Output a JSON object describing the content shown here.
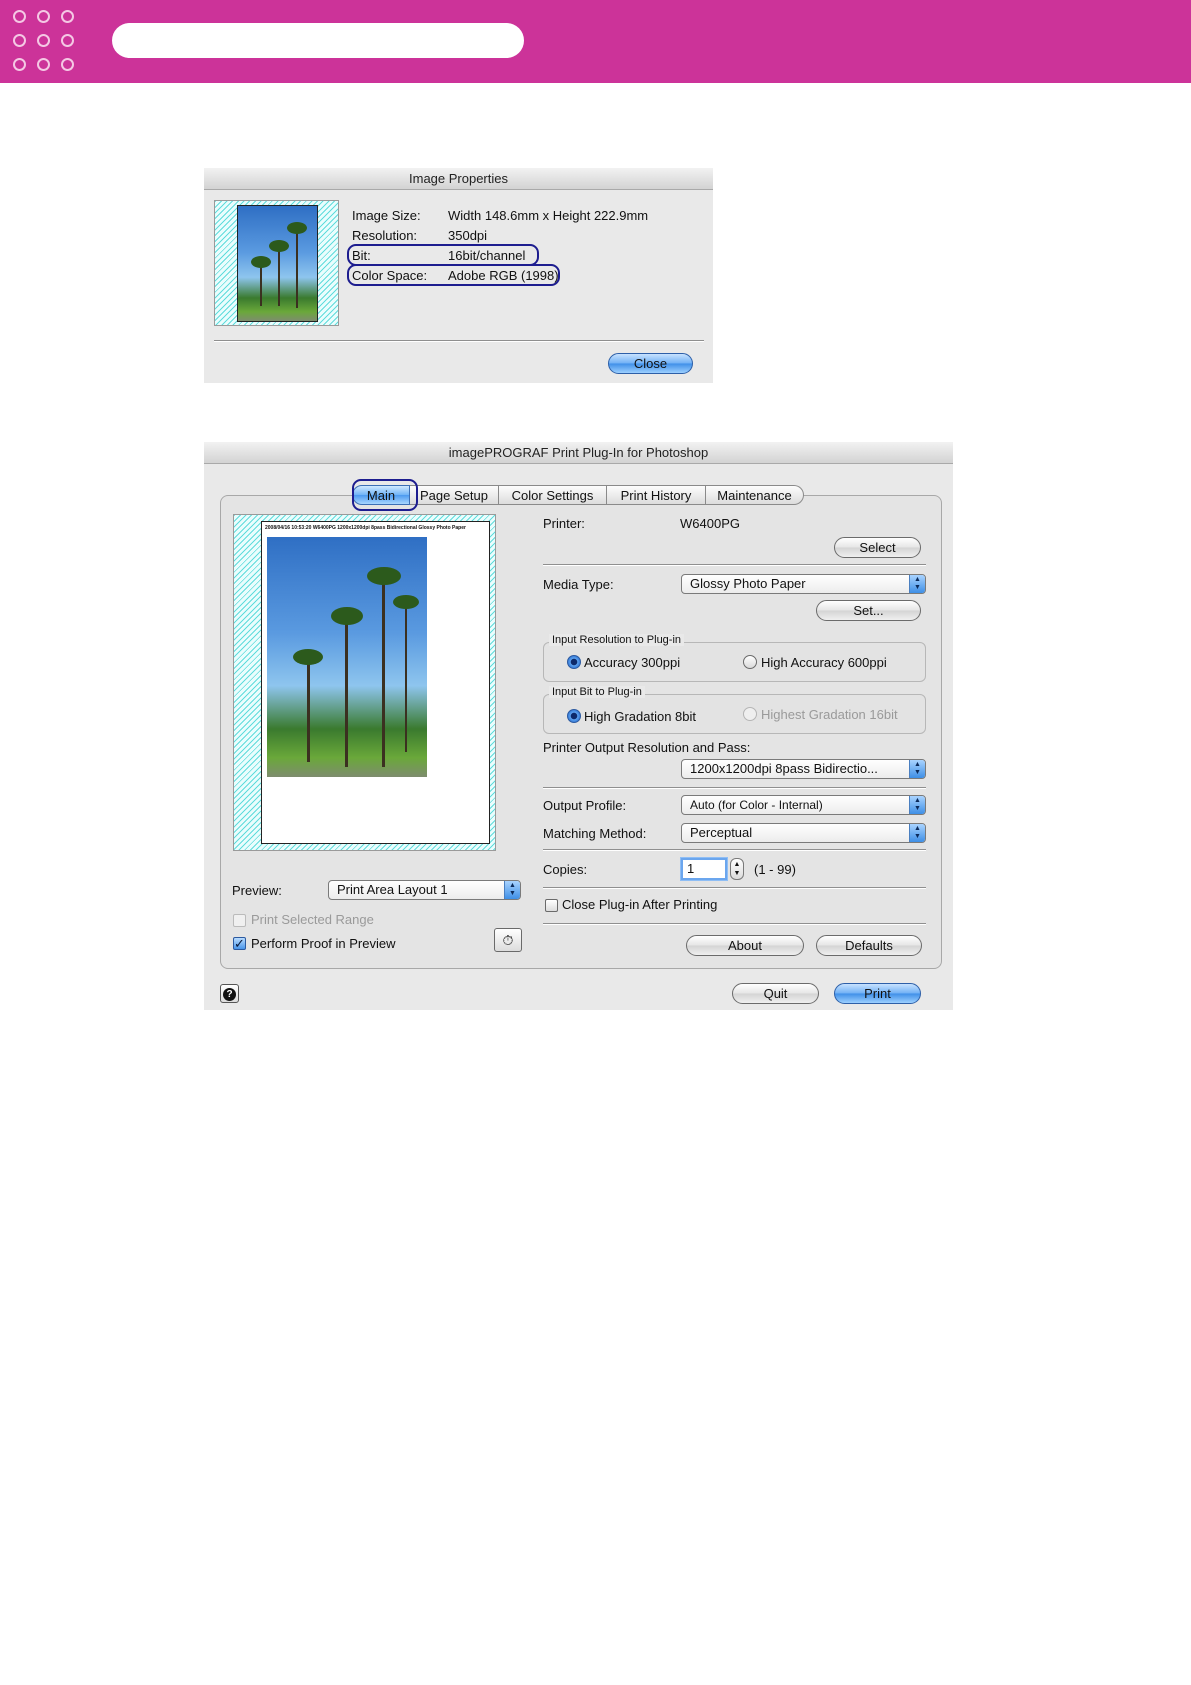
{
  "colors": {
    "banner": "#cc3399",
    "accent_highlight": "#1d1d8f",
    "window_bg": "#e9e9e9"
  },
  "image_properties": {
    "title": "Image Properties",
    "rows": [
      {
        "label": "Image Size:",
        "value": "Width 148.6mm x Height 222.9mm"
      },
      {
        "label": "Resolution:",
        "value": "350dpi"
      },
      {
        "label": "Bit:",
        "value": "16bit/channel"
      },
      {
        "label": "Color Space:",
        "value": "Adobe RGB (1998)"
      }
    ],
    "close_label": "Close"
  },
  "plugin": {
    "title": "imagePROGRAF Print Plug-In for Photoshop",
    "tabs": [
      "Main",
      "Page Setup",
      "Color Settings",
      "Print History",
      "Maintenance"
    ],
    "active_tab": "Main",
    "preview_header_text": "2008/04/16 10:53:20 W6400PG 1200x1200dpi 8pass Bidirectional Glossy Photo Paper",
    "printer_label": "Printer:",
    "printer_value": "W6400PG",
    "select_label": "Select",
    "media_type_label": "Media Type:",
    "media_type_value": "Glossy Photo Paper",
    "set_label": "Set...",
    "input_resolution": {
      "label": "Input Resolution to Plug-in",
      "option1": "Accuracy 300ppi",
      "option2": "High Accuracy 600ppi"
    },
    "input_bit": {
      "label": "Input Bit to Plug-in",
      "option1": "High Gradation 8bit",
      "option2": "Highest Gradation 16bit"
    },
    "output_resolution_label": "Printer Output Resolution and Pass:",
    "output_resolution_value": "1200x1200dpi 8pass Bidirectio...",
    "output_profile_label": "Output Profile:",
    "output_profile_value": "Auto (for Color - Internal)",
    "matching_method_label": "Matching Method:",
    "matching_method_value": "Perceptual",
    "copies_label": "Copies:",
    "copies_value": "1",
    "copies_range": "(1 - 99)",
    "close_after_printing": "Close Plug-in After Printing",
    "preview_label": "Preview:",
    "preview_value": "Print Area Layout 1",
    "print_selected_range": "Print Selected Range",
    "perform_proof": "Perform Proof in Preview",
    "about_label": "About",
    "defaults_label": "Defaults",
    "quit_label": "Quit",
    "print_label": "Print",
    "help_icon_text": "?"
  }
}
